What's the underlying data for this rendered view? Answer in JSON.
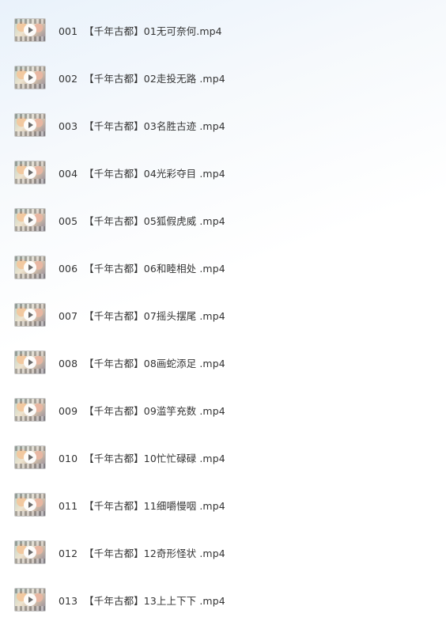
{
  "files": [
    {
      "index": "001",
      "name": "【千年古都】01无可奈何.mp4"
    },
    {
      "index": "002",
      "name": "【千年古都】02走投无路 .mp4"
    },
    {
      "index": "003",
      "name": "【千年古都】03名胜古迹 .mp4"
    },
    {
      "index": "004",
      "name": "【千年古都】04光彩夺目 .mp4"
    },
    {
      "index": "005",
      "name": "【千年古都】05狐假虎威 .mp4"
    },
    {
      "index": "006",
      "name": "【千年古都】06和睦相处 .mp4"
    },
    {
      "index": "007",
      "name": "【千年古都】07摇头摆尾 .mp4"
    },
    {
      "index": "008",
      "name": "【千年古都】08画蛇添足 .mp4"
    },
    {
      "index": "009",
      "name": "【千年古都】09滥竽充数 .mp4"
    },
    {
      "index": "010",
      "name": "【千年古都】10忙忙碌碌 .mp4"
    },
    {
      "index": "011",
      "name": "【千年古都】11细嚼慢咽 .mp4"
    },
    {
      "index": "012",
      "name": "【千年古都】12奇形怪状 .mp4"
    },
    {
      "index": "013",
      "name": "【千年古都】13上上下下 .mp4"
    }
  ],
  "icons": {
    "thumbnail": "video-thumbnail-icon",
    "play": "play-icon"
  }
}
